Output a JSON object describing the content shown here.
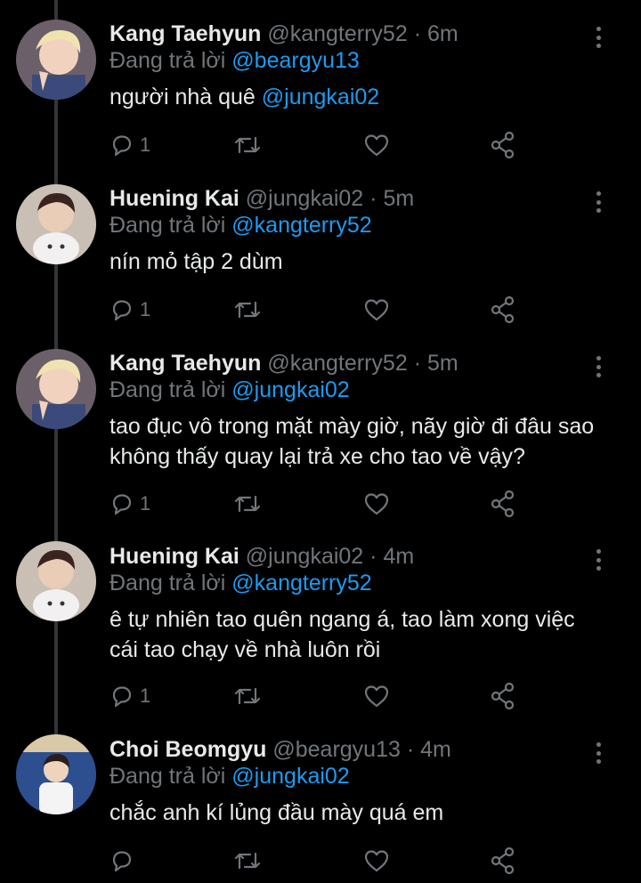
{
  "replying_label": "Đang trả lời",
  "tweets": [
    {
      "name": "Kang Taehyun",
      "handle": "@kangterry52",
      "dot": "·",
      "time": "6m",
      "reply_to": "@beargyu13",
      "text_pre": "người nhà quê ",
      "text_mention": "@jungkai02",
      "reply_count": "1"
    },
    {
      "name": "Huening Kai",
      "handle": "@jungkai02",
      "dot": "·",
      "time": "5m",
      "reply_to": "@kangterry52",
      "text_pre": "nín mỏ tập 2 dùm",
      "text_mention": "",
      "reply_count": "1"
    },
    {
      "name": "Kang Taehyun",
      "handle": "@kangterry52",
      "dot": "·",
      "time": "5m",
      "reply_to": "@jungkai02",
      "text_pre": "tao đục vô trong mặt mày giờ, nãy giờ đi đâu sao không thấy quay lại trả xe cho tao về vậy?",
      "text_mention": "",
      "reply_count": "1"
    },
    {
      "name": "Huening Kai",
      "handle": "@jungkai02",
      "dot": "·",
      "time": "4m",
      "reply_to": "@kangterry52",
      "text_pre": "ê tự nhiên tao quên ngang á, tao làm xong việc cái tao chạy về nhà luôn rồi",
      "text_mention": "",
      "reply_count": "1"
    },
    {
      "name": "Choi Beomgyu",
      "handle": "@beargyu13",
      "dot": "·",
      "time": "4m",
      "reply_to": "@jungkai02",
      "text_pre": "chắc anh kí lủng đầu mày quá em",
      "text_mention": "",
      "reply_count": ""
    }
  ],
  "icons": {
    "more": "more-vertical-icon",
    "reply": "reply-icon",
    "retweet": "retweet-icon",
    "like": "heart-icon",
    "share": "share-icon"
  },
  "colors": {
    "background": "#000000",
    "text": "#e7e9ea",
    "muted": "#71767b",
    "mention": "#1d9bf0",
    "thread_line": "#333639"
  }
}
